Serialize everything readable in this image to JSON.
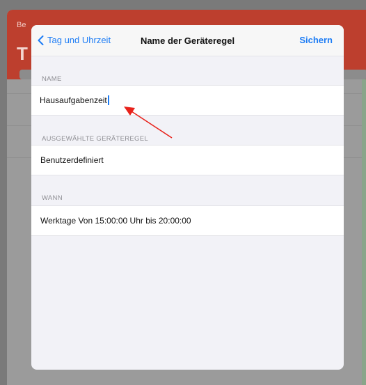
{
  "background_app": {
    "back_label": "Be",
    "title_letter": "T"
  },
  "navbar": {
    "back_label": "Tag und Uhrzeit",
    "title": "Name der Geräteregel",
    "save_label": "Sichern"
  },
  "sections": {
    "name_header": "NAME",
    "name_value": "Hausaufgabenzeit",
    "rule_header": "AUSGEWÄHLTE GERÄTEREGEL",
    "rule_value": "Benutzerdefiniert",
    "when_header": "WANN",
    "when_value": "Werktage Von 15:00:00 Uhr bis 20:00:00"
  },
  "colors": {
    "accent": "#1c7cf5",
    "header_red": "#bd3f2e",
    "annotation": "#e8221b"
  },
  "icons": {
    "back": "chevron-left-icon",
    "annotation": "arrow-icon"
  }
}
